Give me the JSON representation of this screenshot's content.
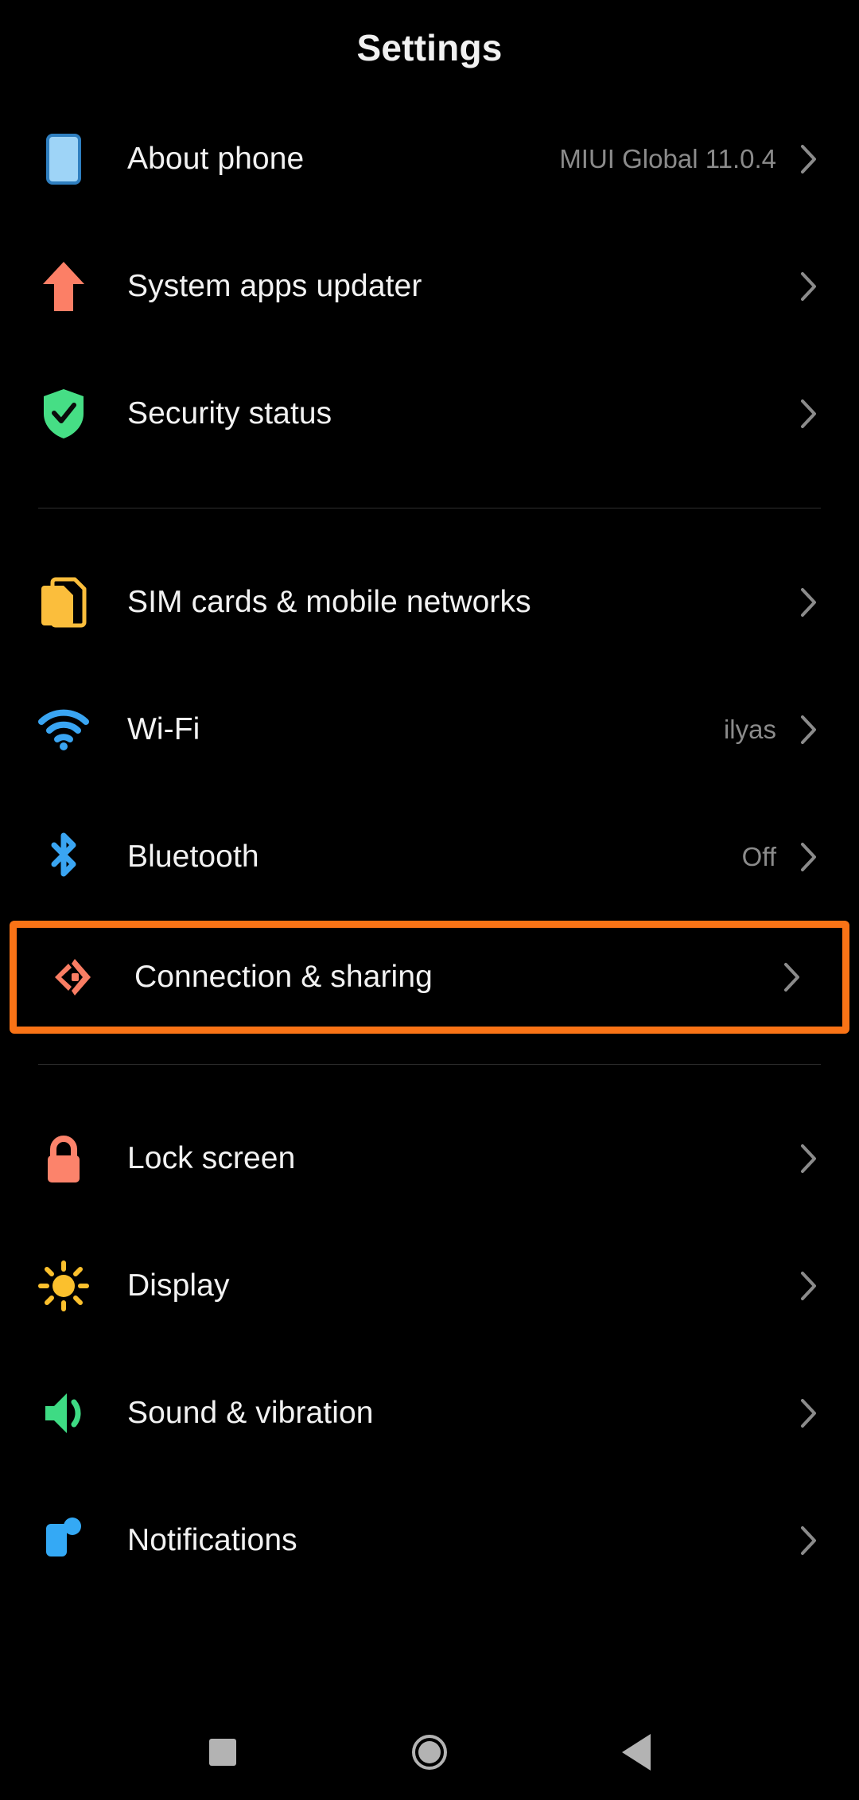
{
  "header": {
    "title": "Settings"
  },
  "colors": {
    "background": "#000000",
    "label_text": "#f2f2f2",
    "value_text": "#8b8b8b",
    "chevron": "#8b8b8b",
    "divider": "#2e2e2e",
    "highlight_border": "#f97316",
    "icon_phone_blue": "#9ed4f7",
    "icon_updater_salmon": "#fc7f66",
    "icon_shield_green": "#46de85",
    "icon_sim_yellow": "#fbbe3c",
    "icon_wifi_blue": "#3aa5f2",
    "icon_bluetooth_blue": "#3aa5f2",
    "icon_connection_salmon": "#fa7d63",
    "icon_lock_salmon": "#fc836b",
    "icon_display_yellow": "#fbc02d",
    "icon_sound_green": "#3edb84",
    "icon_notifications_blue": "#34a9f5",
    "navbar_icon": "#b3b3b3"
  },
  "groups": [
    {
      "id": "group-device",
      "items": [
        {
          "id": "about-phone",
          "label": "About phone",
          "value": "MIUI Global 11.0.4",
          "icon": "phone-icon",
          "highlighted": false
        },
        {
          "id": "system-apps-updater",
          "label": "System apps updater",
          "value": "",
          "icon": "up-arrow-icon",
          "highlighted": false
        },
        {
          "id": "security-status",
          "label": "Security status",
          "value": "",
          "icon": "shield-check-icon",
          "highlighted": false
        }
      ]
    },
    {
      "id": "group-connectivity",
      "items": [
        {
          "id": "sim-cards",
          "label": "SIM cards & mobile networks",
          "value": "",
          "icon": "sim-card-icon",
          "highlighted": false
        },
        {
          "id": "wifi",
          "label": "Wi-Fi",
          "value": "ilyas",
          "icon": "wifi-icon",
          "highlighted": false
        },
        {
          "id": "bluetooth",
          "label": "Bluetooth",
          "value": "Off",
          "icon": "bluetooth-icon",
          "highlighted": false
        },
        {
          "id": "connection-sharing",
          "label": "Connection & sharing",
          "value": "",
          "icon": "connection-sharing-icon",
          "highlighted": true
        }
      ]
    },
    {
      "id": "group-personalization",
      "items": [
        {
          "id": "lock-screen",
          "label": "Lock screen",
          "value": "",
          "icon": "lock-icon",
          "highlighted": false
        },
        {
          "id": "display",
          "label": "Display",
          "value": "",
          "icon": "sun-icon",
          "highlighted": false
        },
        {
          "id": "sound-vibration",
          "label": "Sound & vibration",
          "value": "",
          "icon": "speaker-icon",
          "highlighted": false
        },
        {
          "id": "notifications",
          "label": "Notifications",
          "value": "",
          "icon": "notification-icon",
          "highlighted": false
        }
      ]
    }
  ],
  "navbar": {
    "buttons": [
      {
        "id": "recents",
        "icon": "square-icon",
        "label": "Recents"
      },
      {
        "id": "home",
        "icon": "circle-icon",
        "label": "Home"
      },
      {
        "id": "back",
        "icon": "triangle-icon",
        "label": "Back"
      }
    ]
  }
}
